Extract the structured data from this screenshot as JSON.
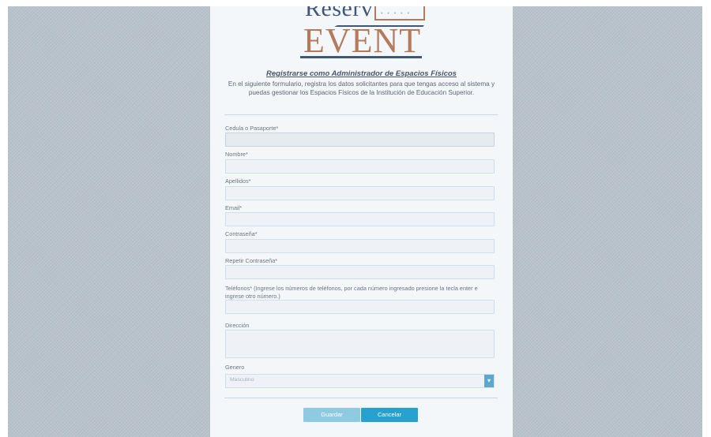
{
  "brand": {
    "logo_top": "Reserv",
    "logo_bottom": "EVENT",
    "logo_dots": "• • • • •"
  },
  "page": {
    "title": "Registrarse como Administrador de Espacios Físicos",
    "description": "En el siguiente formulario, registra los datos solicitantes para que tengas acceso al sistema y puedas gestionar los Espacios Físicos de la Institución de Educación Superior."
  },
  "form": {
    "cedula_label": "Cedula o Pasaporte*",
    "cedula_value": "",
    "nombre_label": "Nombre*",
    "nombre_value": "",
    "apellidos_label": "Apellidos*",
    "apellidos_value": "",
    "email_label": "Email*",
    "email_value": "",
    "contrasena_label": "Contraseña*",
    "contrasena_value": "",
    "repetir_label": "Repetir Contraseña*",
    "repetir_value": "",
    "telefonos_label": "Teléfonos* (Ingrese los números de teléfonos, por cada número ingresado presione la tecla enter e ingrese otro número.)",
    "telefonos_value": "",
    "direccion_label": "Dirección",
    "direccion_value": "",
    "genero_label": "Genero",
    "genero_selected": "Masculino",
    "dropdown_icon": "chevron-down-icon"
  },
  "actions": {
    "guardar": "Guardar",
    "cancelar": "Cancelar"
  },
  "colors": {
    "background": "#b9c3cc",
    "panel": "#f4f7fa",
    "primary": "#27a1cf",
    "primary_light": "#8ecbe3",
    "brand_blue": "#41577a",
    "brand_copper": "#b5795c"
  }
}
